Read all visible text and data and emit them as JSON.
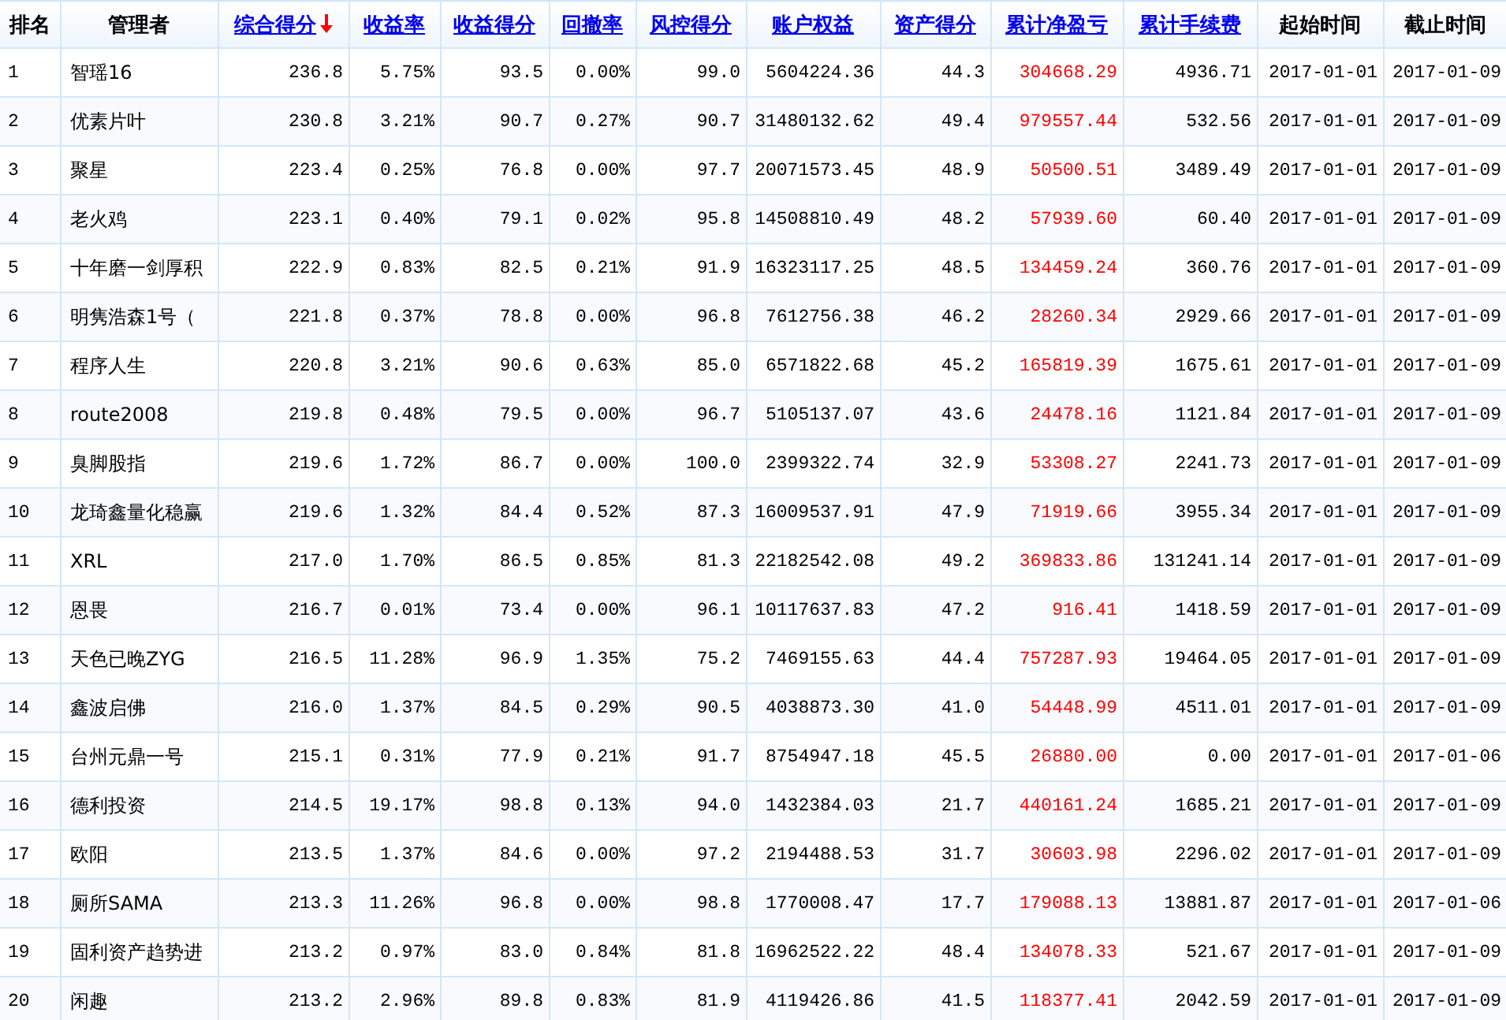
{
  "table": {
    "columns": [
      {
        "label": "排名",
        "link": false,
        "sorted": false
      },
      {
        "label": "管理者",
        "link": false,
        "sorted": false
      },
      {
        "label": "综合得分",
        "link": true,
        "sorted": true
      },
      {
        "label": "收益率",
        "link": true,
        "sorted": false
      },
      {
        "label": "收益得分",
        "link": true,
        "sorted": false
      },
      {
        "label": "回撤率",
        "link": true,
        "sorted": false
      },
      {
        "label": "风控得分",
        "link": true,
        "sorted": false
      },
      {
        "label": "账户权益",
        "link": true,
        "sorted": false
      },
      {
        "label": "资产得分",
        "link": true,
        "sorted": false
      },
      {
        "label": "累计净盈亏",
        "link": true,
        "sorted": false,
        "color": "#ff0000"
      },
      {
        "label": "累计手续费",
        "link": true,
        "sorted": false
      },
      {
        "label": "起始时间",
        "link": false,
        "sorted": false
      },
      {
        "label": "截止时间",
        "link": false,
        "sorted": false
      }
    ],
    "rows": [
      [
        "1",
        "智瑶16",
        "236.8",
        "5.75%",
        "93.5",
        "0.00%",
        "99.0",
        "5604224.36",
        "44.3",
        "304668.29",
        "4936.71",
        "2017-01-01",
        "2017-01-09"
      ],
      [
        "2",
        "优素片叶",
        "230.8",
        "3.21%",
        "90.7",
        "0.27%",
        "90.7",
        "31480132.62",
        "49.4",
        "979557.44",
        "532.56",
        "2017-01-01",
        "2017-01-09"
      ],
      [
        "3",
        "聚星",
        "223.4",
        "0.25%",
        "76.8",
        "0.00%",
        "97.7",
        "20071573.45",
        "48.9",
        "50500.51",
        "3489.49",
        "2017-01-01",
        "2017-01-09"
      ],
      [
        "4",
        "老火鸡",
        "223.1",
        "0.40%",
        "79.1",
        "0.02%",
        "95.8",
        "14508810.49",
        "48.2",
        "57939.60",
        "60.40",
        "2017-01-01",
        "2017-01-09"
      ],
      [
        "5",
        "十年磨一剑厚积",
        "222.9",
        "0.83%",
        "82.5",
        "0.21%",
        "91.9",
        "16323117.25",
        "48.5",
        "134459.24",
        "360.76",
        "2017-01-01",
        "2017-01-09"
      ],
      [
        "6",
        "明隽浩森1号（",
        "221.8",
        "0.37%",
        "78.8",
        "0.00%",
        "96.8",
        "7612756.38",
        "46.2",
        "28260.34",
        "2929.66",
        "2017-01-01",
        "2017-01-09"
      ],
      [
        "7",
        "程序人生",
        "220.8",
        "3.21%",
        "90.6",
        "0.63%",
        "85.0",
        "6571822.68",
        "45.2",
        "165819.39",
        "1675.61",
        "2017-01-01",
        "2017-01-09"
      ],
      [
        "8",
        "route2008",
        "219.8",
        "0.48%",
        "79.5",
        "0.00%",
        "96.7",
        "5105137.07",
        "43.6",
        "24478.16",
        "1121.84",
        "2017-01-01",
        "2017-01-09"
      ],
      [
        "9",
        "臭脚股指",
        "219.6",
        "1.72%",
        "86.7",
        "0.00%",
        "100.0",
        "2399322.74",
        "32.9",
        "53308.27",
        "2241.73",
        "2017-01-01",
        "2017-01-09"
      ],
      [
        "10",
        "龙琦鑫量化稳赢",
        "219.6",
        "1.32%",
        "84.4",
        "0.52%",
        "87.3",
        "16009537.91",
        "47.9",
        "71919.66",
        "3955.34",
        "2017-01-01",
        "2017-01-09"
      ],
      [
        "11",
        "XRL",
        "217.0",
        "1.70%",
        "86.5",
        "0.85%",
        "81.3",
        "22182542.08",
        "49.2",
        "369833.86",
        "131241.14",
        "2017-01-01",
        "2017-01-09"
      ],
      [
        "12",
        "恩畏",
        "216.7",
        "0.01%",
        "73.4",
        "0.00%",
        "96.1",
        "10117637.83",
        "47.2",
        "916.41",
        "1418.59",
        "2017-01-01",
        "2017-01-09"
      ],
      [
        "13",
        "天色已晚ZYG",
        "216.5",
        "11.28%",
        "96.9",
        "1.35%",
        "75.2",
        "7469155.63",
        "44.4",
        "757287.93",
        "19464.05",
        "2017-01-01",
        "2017-01-09"
      ],
      [
        "14",
        "鑫波启佛",
        "216.0",
        "1.37%",
        "84.5",
        "0.29%",
        "90.5",
        "4038873.30",
        "41.0",
        "54448.99",
        "4511.01",
        "2017-01-01",
        "2017-01-09"
      ],
      [
        "15",
        "台州元鼎一号",
        "215.1",
        "0.31%",
        "77.9",
        "0.21%",
        "91.7",
        "8754947.18",
        "45.5",
        "26880.00",
        "0.00",
        "2017-01-01",
        "2017-01-06"
      ],
      [
        "16",
        "德利投资",
        "214.5",
        "19.17%",
        "98.8",
        "0.13%",
        "94.0",
        "1432384.03",
        "21.7",
        "440161.24",
        "1685.21",
        "2017-01-01",
        "2017-01-09"
      ],
      [
        "17",
        "欧阳",
        "213.5",
        "1.37%",
        "84.6",
        "0.00%",
        "97.2",
        "2194488.53",
        "31.7",
        "30603.98",
        "2296.02",
        "2017-01-01",
        "2017-01-09"
      ],
      [
        "18",
        "厕所SAMA",
        "213.3",
        "11.26%",
        "96.8",
        "0.00%",
        "98.8",
        "1770008.47",
        "17.7",
        "179088.13",
        "13881.87",
        "2017-01-01",
        "2017-01-06"
      ],
      [
        "19",
        "固利资产趋势进",
        "213.2",
        "0.97%",
        "83.0",
        "0.84%",
        "81.8",
        "16962522.22",
        "48.4",
        "134078.33",
        "521.67",
        "2017-01-01",
        "2017-01-09"
      ],
      [
        "20",
        "闲趣",
        "213.2",
        "2.96%",
        "89.8",
        "0.83%",
        "81.9",
        "4119426.86",
        "41.5",
        "118377.41",
        "2042.59",
        "2017-01-01",
        "2017-01-09"
      ]
    ]
  }
}
